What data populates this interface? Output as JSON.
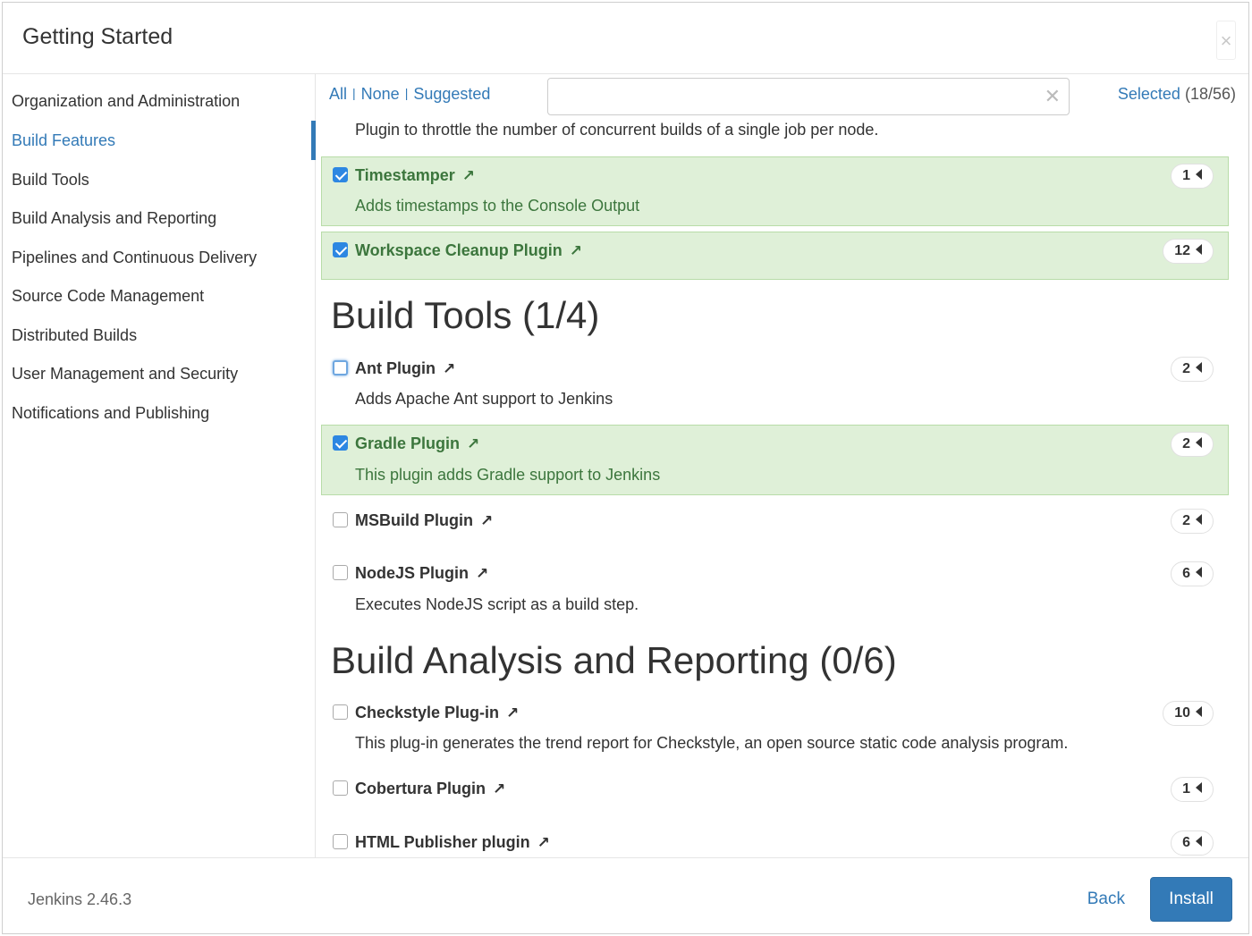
{
  "header": {
    "title": "Getting Started",
    "close_icon": "×"
  },
  "sidebar": {
    "items": [
      {
        "label": "Organization and Administration"
      },
      {
        "label": "Build Features",
        "active": true
      },
      {
        "label": "Build Tools"
      },
      {
        "label": "Build Analysis and Reporting"
      },
      {
        "label": "Pipelines and Continuous Delivery"
      },
      {
        "label": "Source Code Management"
      },
      {
        "label": "Distributed Builds"
      },
      {
        "label": "User Management and Security"
      },
      {
        "label": "Notifications and Publishing"
      }
    ]
  },
  "toolbar": {
    "filter_all": "All",
    "filter_none": "None",
    "filter_suggested": "Suggested",
    "search_value": "",
    "selected_link": "Selected",
    "selected_count": "(18/56)"
  },
  "list": {
    "truncated_desc": "Plugin to throttle the number of concurrent builds of a single job per node.",
    "plugins": [
      {
        "name": "Timestamper",
        "desc": "Adds timestamps to the Console Output",
        "deps": "1",
        "checked": true
      },
      {
        "name": "Workspace Cleanup Plugin",
        "desc": "",
        "deps": "12",
        "checked": true
      },
      {
        "name": "Ant Plugin",
        "desc": "Adds Apache Ant support to Jenkins",
        "deps": "2",
        "checked": false
      },
      {
        "name": "Gradle Plugin",
        "desc": "This plugin adds Gradle support to Jenkins",
        "deps": "2",
        "checked": true
      },
      {
        "name": "MSBuild Plugin",
        "desc": "",
        "deps": "2",
        "checked": false
      },
      {
        "name": "NodeJS Plugin",
        "desc": "Executes NodeJS script as a build step.",
        "deps": "6",
        "checked": false
      },
      {
        "name": "Checkstyle Plug-in",
        "desc": "This plug-in generates the trend report for Checkstyle, an open source static code analysis program.",
        "deps": "10",
        "checked": false
      },
      {
        "name": "Cobertura Plugin",
        "desc": "",
        "deps": "1",
        "checked": false
      },
      {
        "name": "HTML Publisher plugin",
        "desc": "",
        "deps": "6",
        "checked": false
      }
    ],
    "sections": [
      {
        "title": "Build Tools (1/4)"
      },
      {
        "title": "Build Analysis and Reporting (0/6)"
      }
    ],
    "external_link_icon": "↗"
  },
  "footer": {
    "version": "Jenkins 2.46.3",
    "back_label": "Back",
    "install_label": "Install"
  },
  "colors": {
    "accent": "#337ab7",
    "selected_bg": "#dff0d8",
    "selected_text": "#3c763d"
  }
}
